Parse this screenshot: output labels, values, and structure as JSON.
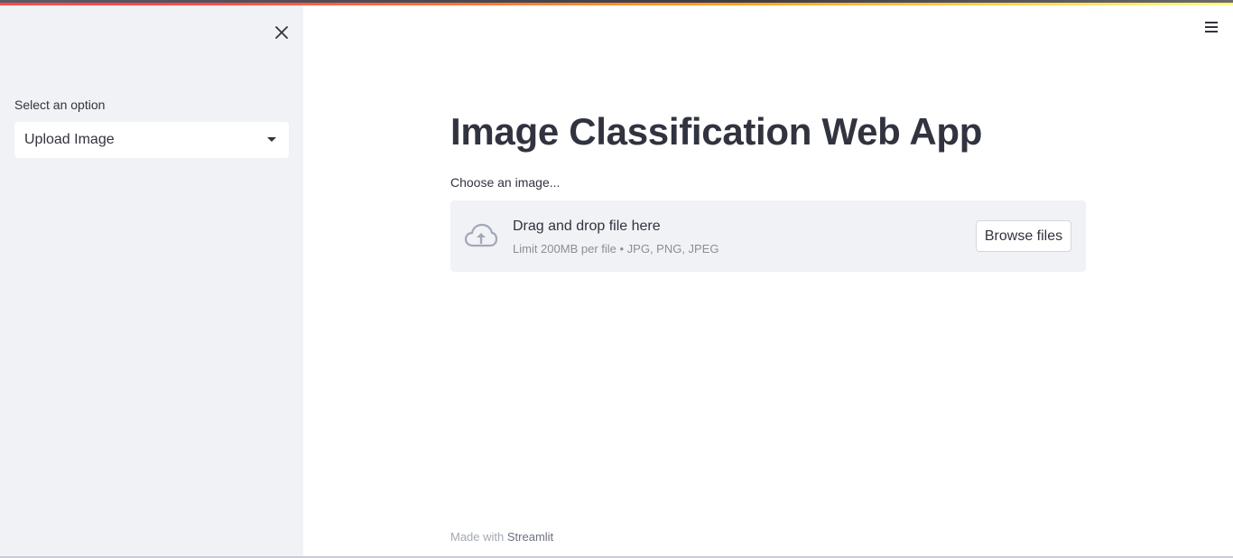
{
  "sidebar": {
    "select_label": "Select an option",
    "selected_option": "Upload Image"
  },
  "main": {
    "title": "Image Classification Web App",
    "uploader": {
      "label": "Choose an image...",
      "dropzone_title": "Drag and drop file here",
      "limit_text": "Limit 200MB per file • JPG, PNG, JPEG",
      "browse_label": "Browse files"
    }
  },
  "footer": {
    "prefix": "Made with",
    "link": "Streamlit"
  },
  "icons": {
    "close": "close-icon",
    "menu": "hamburger-menu-icon",
    "upload": "cloud-upload-icon",
    "caret": "caret-down-icon"
  },
  "colors": {
    "sidebar_bg": "#f0f2f6",
    "text": "#31333f",
    "muted": "#8c8e96",
    "accent_red": "#ff4b4b"
  }
}
